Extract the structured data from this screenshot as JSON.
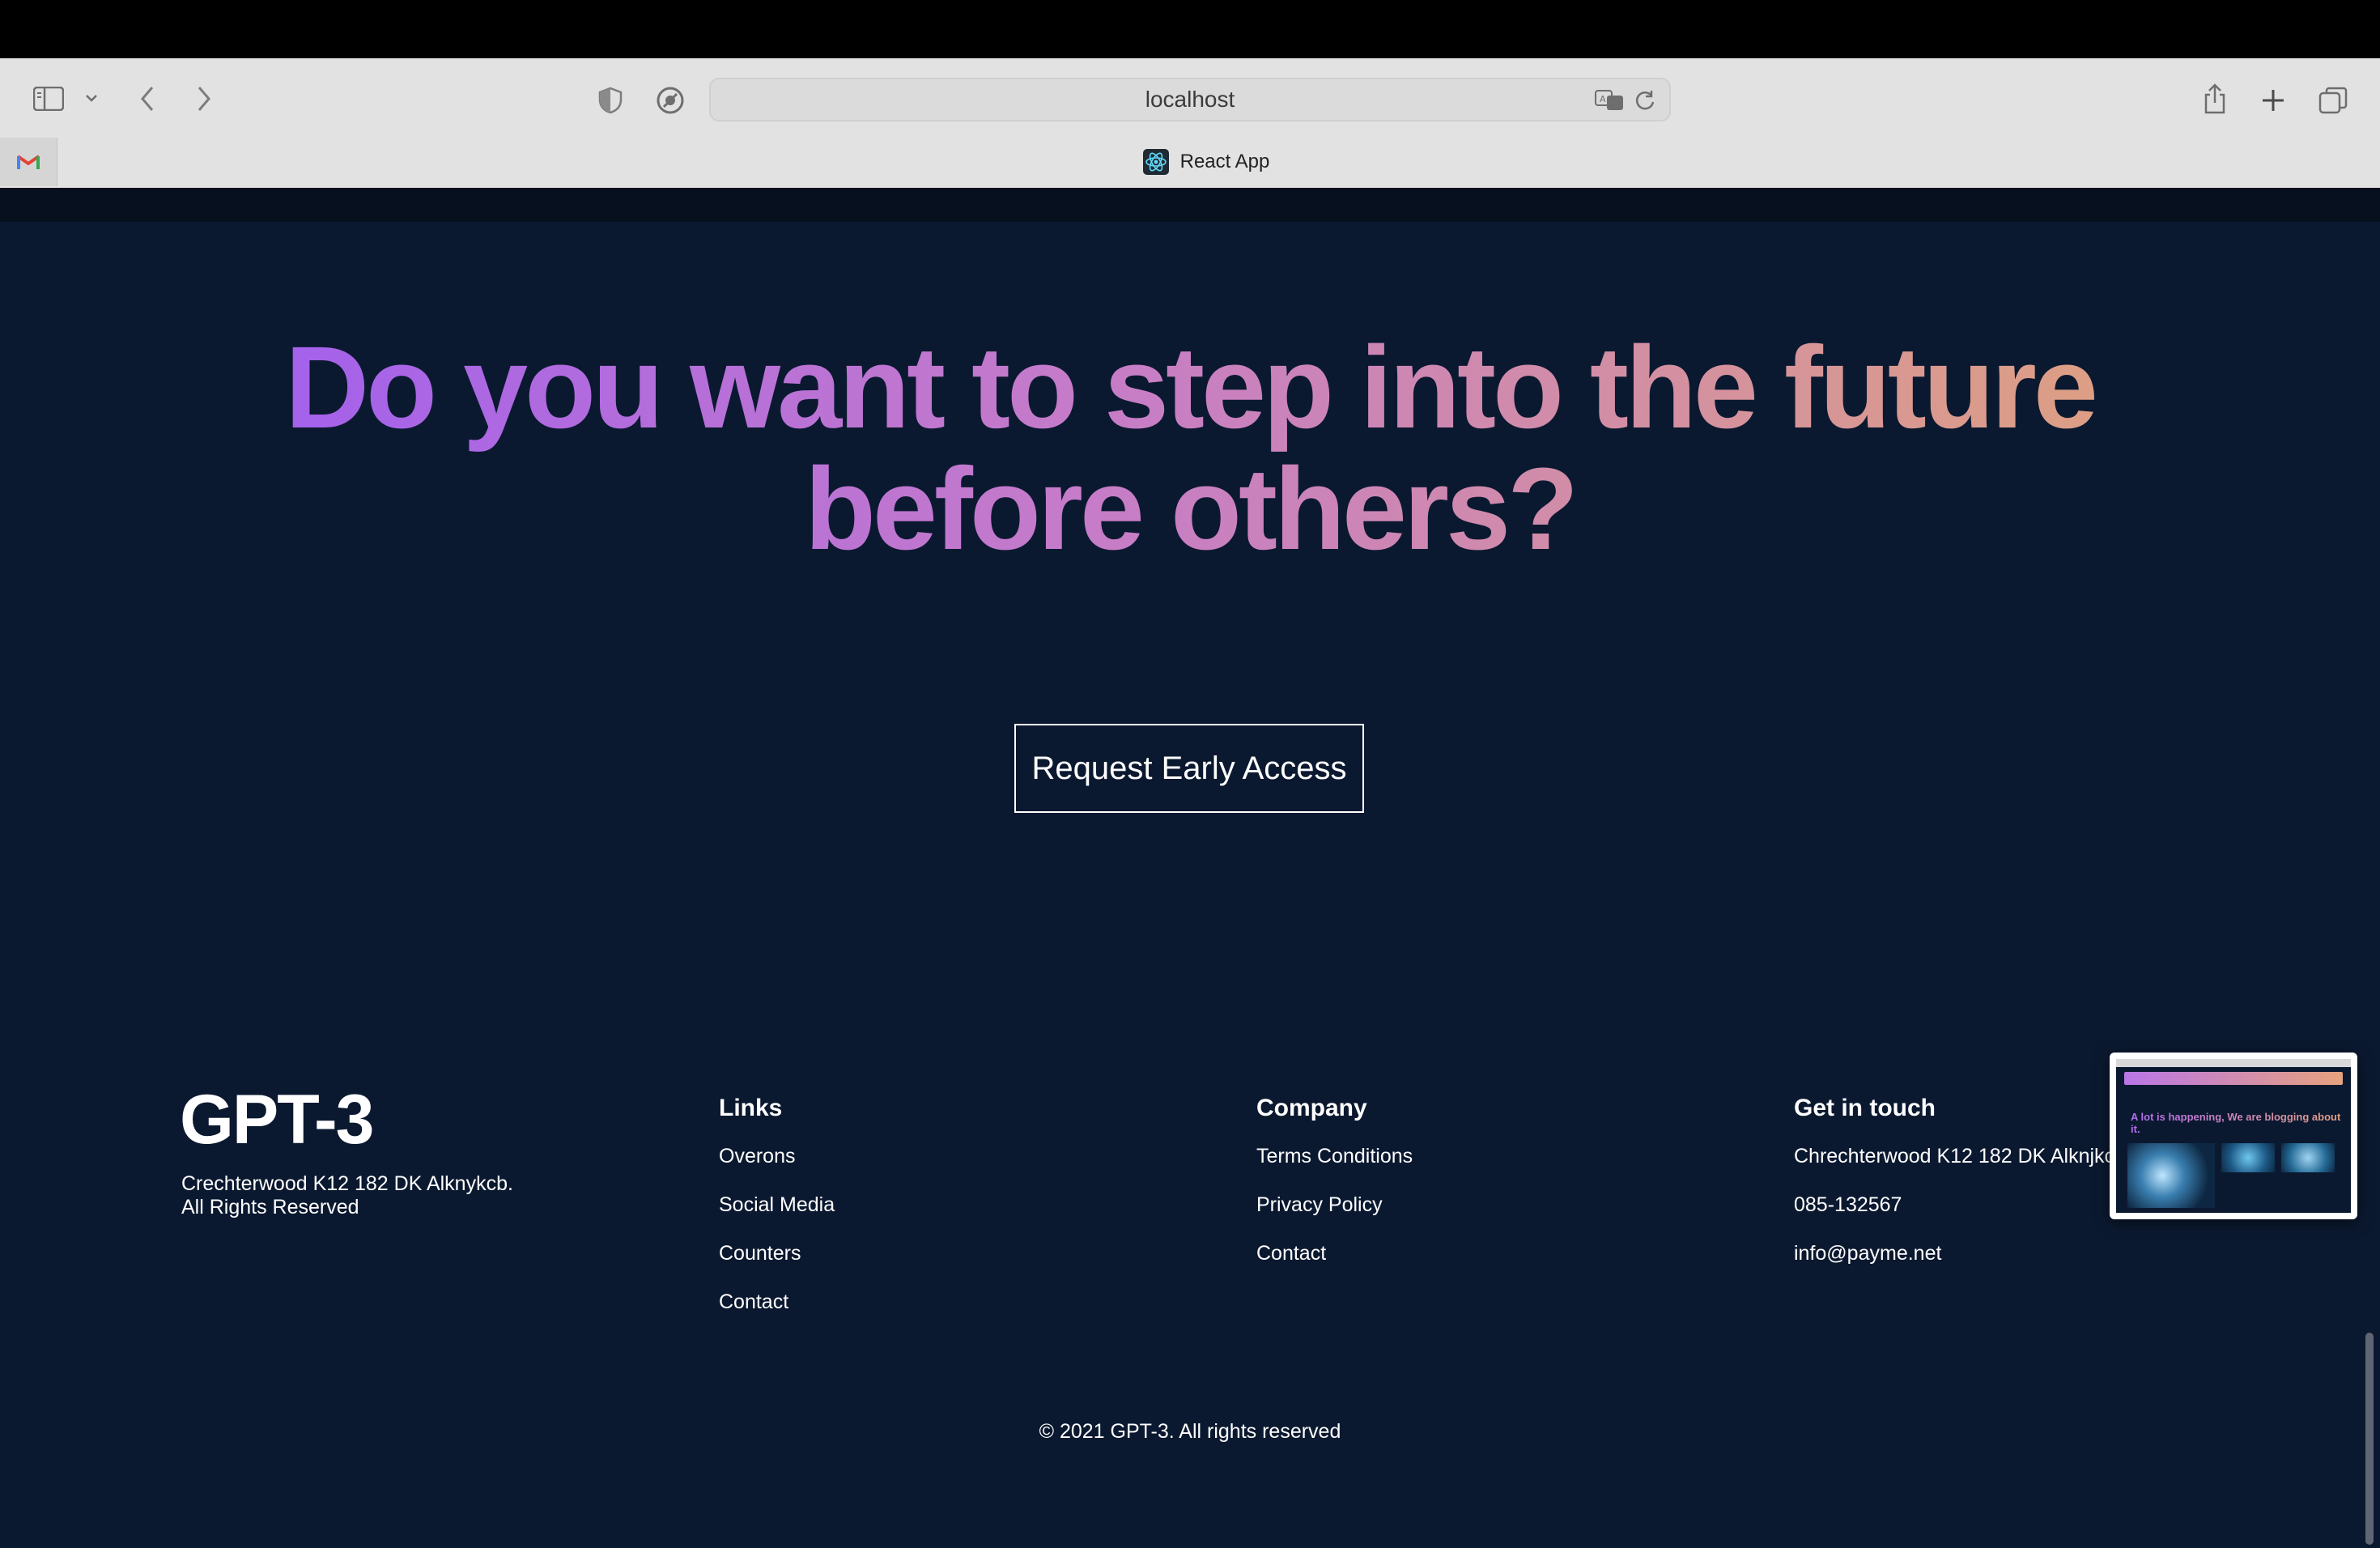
{
  "browser": {
    "url": "localhost",
    "active_tab_title": "React App"
  },
  "cta": {
    "headline": "Do you want to step into the future before others?",
    "button_label": "Request Early Access"
  },
  "footer": {
    "logo": "GPT-3",
    "address_line1": "Crechterwood K12 182 DK Alknykcb.",
    "address_line2": "All Rights Reserved",
    "columns": {
      "links": {
        "heading": "Links",
        "items": [
          "Overons",
          "Social Media",
          "Counters",
          "Contact"
        ]
      },
      "company": {
        "heading": "Company",
        "items": [
          "Terms Conditions",
          "Privacy Policy",
          "Contact"
        ]
      },
      "contact": {
        "heading": "Get in touch",
        "items": [
          "Chrechterwood K12 182 DK Alknjkcd",
          "085-132567",
          "info@payme.net"
        ]
      }
    },
    "copyright": "© 2021 GPT-3. All rights reserved"
  },
  "thumbnail": {
    "title": "A lot is happening, We are blogging about it."
  },
  "colors": {
    "page_background": "#0b1930",
    "gradient_start": "#9f5df0",
    "gradient_end": "#e0a37c"
  }
}
